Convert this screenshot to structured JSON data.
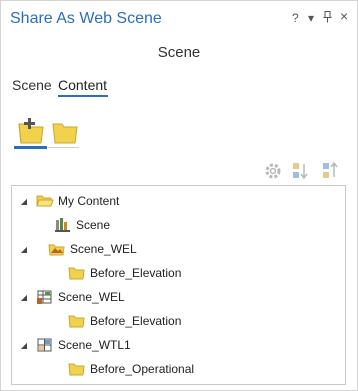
{
  "window": {
    "title": "Share As Web Scene",
    "controls": {
      "help": "?",
      "menu": "▾",
      "pin": "ᵠ",
      "close": "×"
    }
  },
  "page_subtitle": "Scene",
  "tabs": [
    {
      "label": "Scene",
      "active": false
    },
    {
      "label": "Content",
      "active": true
    }
  ],
  "mode_buttons": [
    {
      "icon": "add-folder-icon",
      "active": true
    },
    {
      "icon": "folder-icon",
      "active": false
    }
  ],
  "toolbar_icons": [
    "settings-icon",
    "sort-ascending-icon",
    "sort-descending-icon"
  ],
  "tree": {
    "root": {
      "label": "My Content",
      "icon": "open-folder-icon"
    },
    "items": [
      {
        "label": "Scene",
        "icon": "scene-icon",
        "level": 1,
        "expandable": false
      },
      {
        "label": "Scene_WEL",
        "icon": "web-elevation-layer-icon",
        "level": 1,
        "expandable": true,
        "expanded": true
      },
      {
        "label": "Before_Elevation",
        "icon": "folder-icon",
        "level": 2,
        "expandable": false
      },
      {
        "label": "Scene_WEL",
        "icon": "web-elevation-layer-icon",
        "level": 1,
        "expandable": true,
        "expanded": true
      },
      {
        "label": "Before_Elevation",
        "icon": "folder-icon",
        "level": 2,
        "expandable": false
      },
      {
        "label": "Scene_WTL1",
        "icon": "web-tile-layer-icon",
        "level": 1,
        "expandable": true,
        "expanded": true
      },
      {
        "label": "Before_Operational",
        "icon": "folder-icon",
        "level": 2,
        "expandable": false
      }
    ]
  },
  "colors": {
    "accent": "#2a6ebb",
    "folder": "#f2d14c",
    "folder_dark": "#c9a72e"
  }
}
